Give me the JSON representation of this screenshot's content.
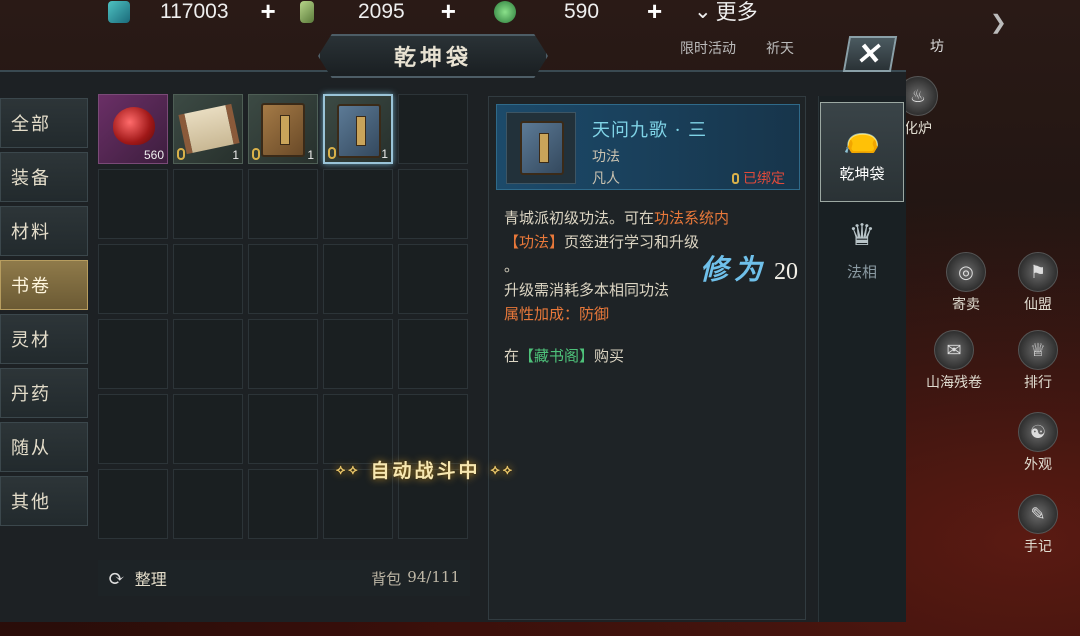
{
  "topbar": {
    "resource1": {
      "value": "117003",
      "plus": "+"
    },
    "resource2": {
      "value": "2095",
      "plus": "+"
    },
    "resource3": {
      "value": "590",
      "plus": "+"
    },
    "more_label": "更多",
    "events": [
      "限时活动",
      "祈天"
    ],
    "shop_label": "坊"
  },
  "panel": {
    "title": "乾坤袋",
    "close_label": "✕"
  },
  "categories": [
    {
      "label": "全部",
      "active": false
    },
    {
      "label": "装备",
      "active": false
    },
    {
      "label": "材料",
      "active": false
    },
    {
      "label": "书卷",
      "active": true
    },
    {
      "label": "灵材",
      "active": false
    },
    {
      "label": "丹药",
      "active": false
    },
    {
      "label": "随从",
      "active": false
    },
    {
      "label": "其他",
      "active": false
    }
  ],
  "items": [
    {
      "name": "red-orb",
      "count": "560",
      "locked": false
    },
    {
      "name": "scroll",
      "count": "1",
      "locked": true
    },
    {
      "name": "brown-book",
      "count": "1",
      "locked": true
    },
    {
      "name": "blue-book",
      "count": "1",
      "locked": true,
      "selected": true
    }
  ],
  "bag": {
    "sort_label": "整理",
    "capacity_label": "背包",
    "capacity_value": "94/111"
  },
  "detail": {
    "name": "天问九歌 · 三",
    "type": "功法",
    "rank": "凡人",
    "bound": "已绑定",
    "desc_part1": "青城派初级功法。可在",
    "desc_link1": "功法系统内",
    "desc_link2": "【功法】",
    "desc_part2": "页签进行学习和升级",
    "desc_dot": "。",
    "upgrade": "升级需消耗多本相同功法",
    "attr": "属性加成：防御",
    "buy_prefix": "在",
    "buy_place": "【藏书阁】",
    "buy_suffix": "购买"
  },
  "cultivation": {
    "label": "修为",
    "value": "20"
  },
  "auto_battle": "自动战斗中",
  "right_tabs": [
    {
      "label": "乾坤袋",
      "active": true,
      "icon": "bag-icon"
    },
    {
      "label": "法相",
      "active": false,
      "icon": "mask-icon"
    }
  ],
  "side_menu": [
    "化炉",
    "寄卖",
    "仙盟",
    "山海残卷",
    "排行",
    "外观",
    "手记"
  ]
}
